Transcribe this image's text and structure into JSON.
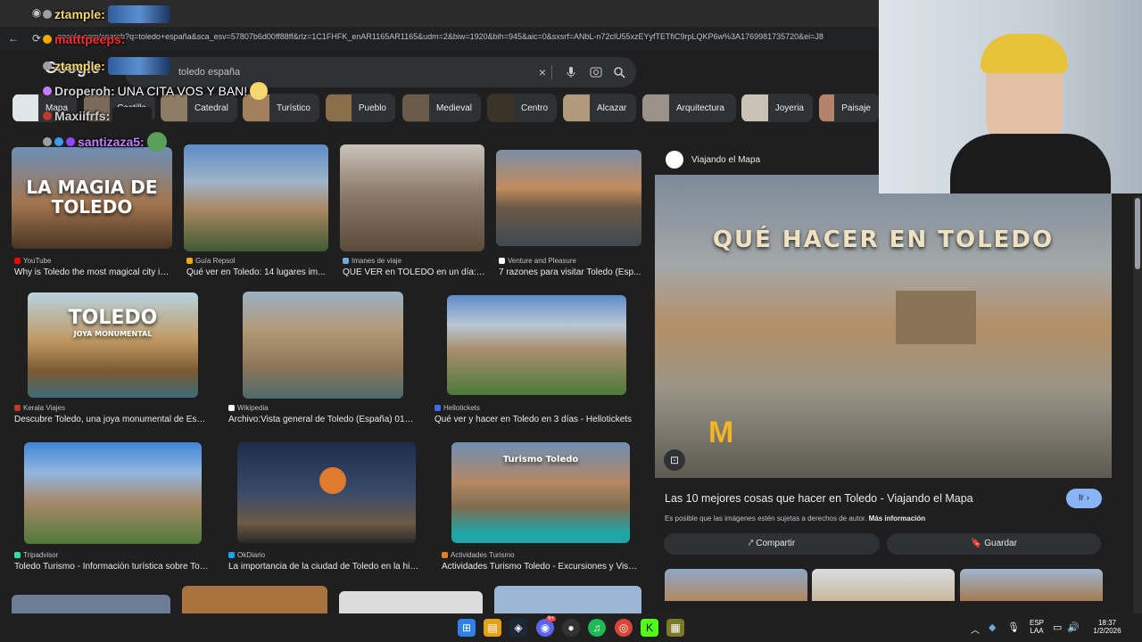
{
  "browser": {
    "url": "google.com/search?q=toledo+españa&sca_esv=57807b6d00ff88ff&rlz=1C1FHFK_enAR1165AR1165&udm=2&biw=1920&bih=945&aic=0&sxsrf=ANbL-n72clU55xzEYyfTETfiC9rpLQKP6w%3A1769981735720&ei=J8"
  },
  "search": {
    "logo": "Google",
    "query": "toledo españa",
    "clear_icon": "×",
    "mic_icon": "mic-icon",
    "lens_icon": "lens-icon",
    "search_icon": "search-icon"
  },
  "chips": [
    {
      "label": "Mapa"
    },
    {
      "label": "Castillo"
    },
    {
      "label": "Catedral"
    },
    {
      "label": "Turístico"
    },
    {
      "label": "Pueblo"
    },
    {
      "label": "Medieval"
    },
    {
      "label": "Centro"
    },
    {
      "label": "Alcazar"
    },
    {
      "label": "Arquitectura"
    },
    {
      "label": "Joyeria"
    },
    {
      "label": "Paisaje"
    }
  ],
  "results": [
    {
      "source": "YouTube",
      "title": "Why is Toledo the most magical city in ...",
      "overlay": "LA MAGIA DE TOLEDO",
      "fav": "#ff0000"
    },
    {
      "source": "Guía Repsol",
      "title": "Qué ver en Toledo: 14 lugares im...",
      "fav": "#f2a900"
    },
    {
      "source": "Imanes de viaje",
      "title": "QUÉ VER en TOLEDO en un día: ...",
      "fav": "#6fa8dc"
    },
    {
      "source": "Venture and Pleasure",
      "title": "7 razones para visitar Toledo (Esp...",
      "fav": "#ffffff"
    },
    {
      "source": "Kerala Viajes",
      "title": "Descubre Toledo, una joya monumental de Espa...",
      "overlay": "TOLEDO",
      "overlay_sub": "JOYA MONUMENTAL",
      "fav": "#c0392b"
    },
    {
      "source": "Wikipedia",
      "title": "Archivo:Vista general de Toledo (España) 01.jp...",
      "fav": "#ffffff"
    },
    {
      "source": "Hellotickets",
      "title": "Qué ver y hacer en Toledo en 3 días - Hellotickets",
      "fav": "#3d6ee8"
    },
    {
      "source": "Tripadvisor",
      "title": "Toledo Turismo - Información turística sobre Tole...",
      "fav": "#34e0a1"
    },
    {
      "source": "OkDiario",
      "title": "La importancia de la ciudad de Toledo en la histo...",
      "fav": "#1da1f2"
    },
    {
      "source": "Actividades Turismo",
      "title": "Actividades Turismo Toledo - Excursiones y Visita...",
      "overlay": "Turismo Toledo",
      "fav": "#e67e22"
    }
  ],
  "panel": {
    "site": "Viajando el Mapa",
    "image_text": "QUÉ HACER EN TOLEDO",
    "title": "Las 10 mejores cosas que hacer en Toledo - Viajando el Mapa",
    "button_ir": "Ir",
    "notice": "Es posible que las imágenes estén sujetas a derechos de autor.",
    "more_info": "Más información",
    "share": "Compartir",
    "save": "Guardar"
  },
  "chat": [
    {
      "user": "ztample:",
      "color": "#f5d76e",
      "text": ""
    },
    {
      "user": "matttpeeps:",
      "color": "#ff2d2d",
      "text": ""
    },
    {
      "user": "ztample:",
      "color": "#f5d76e",
      "text": ""
    },
    {
      "user": "Droperoh:",
      "color": "#d0d0d0",
      "text": "UNA CITA VOS Y BAN!"
    },
    {
      "user": "Maxiifrfs:",
      "color": "#d0d0d0",
      "text": ""
    },
    {
      "user": "santizaza5:",
      "color": "#c77dff",
      "text": ""
    }
  ],
  "taskbar": {
    "lang_top": "ESP",
    "lang_bottom": "LAA",
    "time": "18:37",
    "date": "1/2/2026",
    "discord_badge": "9+"
  }
}
